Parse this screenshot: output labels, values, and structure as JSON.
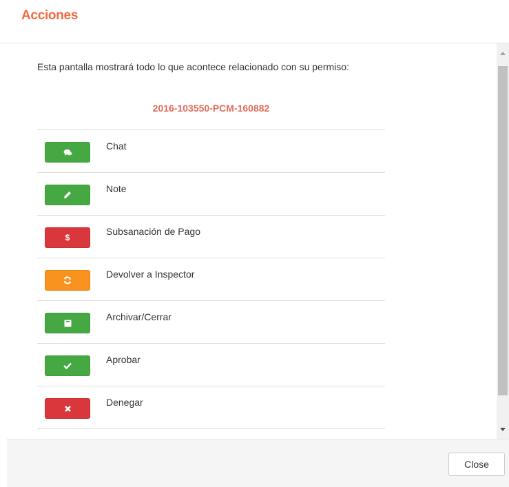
{
  "modal": {
    "title": "Acciones",
    "intro": "Esta pantalla mostrará todo lo que acontece relacionado con su permiso:",
    "permit_id": "2016-103550-PCM-160882",
    "close_label": "Close"
  },
  "actions": [
    {
      "label": "Chat",
      "icon": "chat-bubble-icon",
      "color": "#45a843"
    },
    {
      "label": "Note",
      "icon": "pencil-icon",
      "color": "#45a843"
    },
    {
      "label": "Subsanación de Pago",
      "icon": "dollar-icon",
      "icon_text": "$",
      "color": "#d9373b"
    },
    {
      "label": "Devolver a Inspector",
      "icon": "refresh-icon",
      "color": "#f7931e"
    },
    {
      "label": "Archivar/Cerrar",
      "icon": "archive-icon",
      "color": "#45a843"
    },
    {
      "label": "Aprobar",
      "icon": "check-icon",
      "color": "#45a843"
    },
    {
      "label": "Denegar",
      "icon": "times-icon",
      "color": "#d9373b"
    }
  ],
  "colors": {
    "title": "#f26b43",
    "permit": "#e36b5a",
    "green": "#45a843",
    "red": "#d9373b",
    "orange": "#f7931e"
  }
}
